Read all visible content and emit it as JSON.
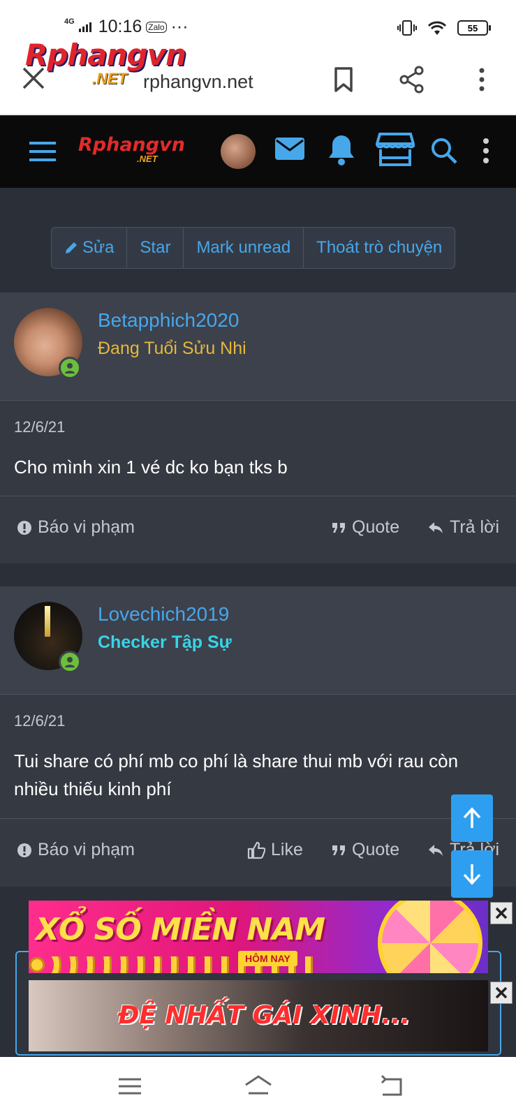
{
  "status_bar": {
    "network": "4G",
    "time": "10:16",
    "dots": "···",
    "zalo": "Zalo",
    "battery": "55"
  },
  "browser": {
    "logo_main": "Rphangvn",
    "logo_sub": ".NET",
    "url": "rphangvn.net"
  },
  "action_bar": {
    "edit": "Sửa",
    "star": "Star",
    "mark_unread": "Mark unread",
    "leave": "Thoát trò chuyện"
  },
  "posts": [
    {
      "username": "Betapphich2020",
      "user_title": "Đang Tuổi Sửu Nhi",
      "user_title_color": "#e6b83a",
      "date": "12/6/21",
      "message": "Cho mình xin 1 vé dc ko bạn tks b",
      "report": "Báo vi phạm",
      "quote": "Quote",
      "reply": "Trả lời"
    },
    {
      "username": "Lovechich2019",
      "user_title": "Checker Tập Sự",
      "user_title_color": "#39d3e6",
      "date": "12/6/21",
      "message": "Tui share có phí mb co phí là share thui mb với rau còn nhiều thiếu kinh phí",
      "report": "Báo vi phạm",
      "like": "Like",
      "quote": "Quote",
      "reply": "Trả lời"
    }
  ],
  "ads": {
    "ad1_title": "XỔ SỐ MIỀN NAM",
    "ad1_sub": "HÔM NAY",
    "ad2_title": "ĐỆ NHẤT GÁI XINH..."
  },
  "colors": {
    "accent": "#47a7eb",
    "bg": "#2b2f38",
    "card": "#353942",
    "header_bg": "#0a0a0a"
  }
}
